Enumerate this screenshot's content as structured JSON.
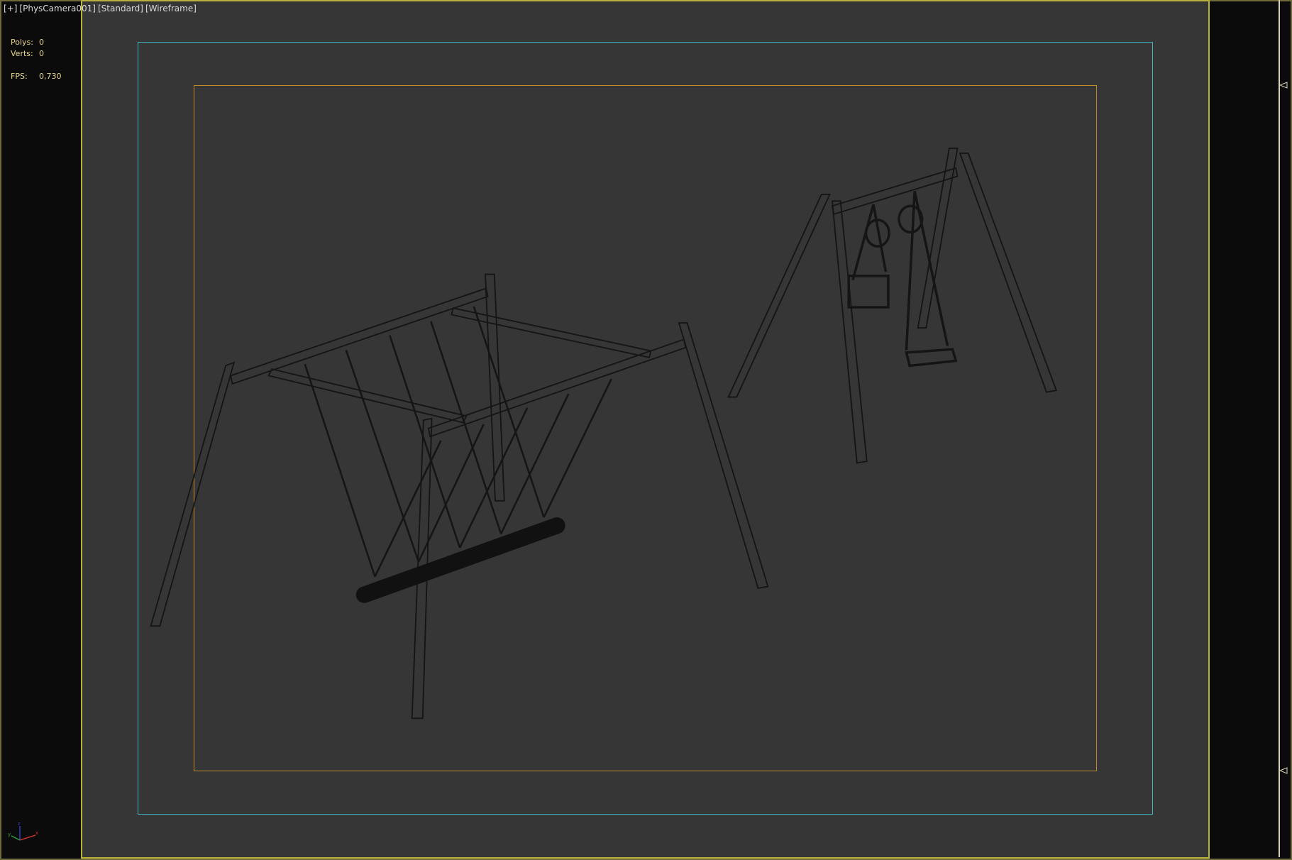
{
  "viewport": {
    "label": [
      "[+]",
      "[PhysCamera001]",
      "[Standard]",
      "[Wireframe]"
    ],
    "stats": [
      {
        "key": "Polys:",
        "value": "0"
      },
      {
        "key": "Verts:",
        "value": "0"
      },
      {
        "key": "FPS:",
        "value": "0,730"
      }
    ],
    "gizmo_axes": [
      "x",
      "y",
      "z"
    ]
  },
  "colors": {
    "viewport_bg": "#363636",
    "active_border": "#b9b23a",
    "safe_frame_outer": "#3fb5bf",
    "safe_frame_inner": "#c08a2a",
    "stats_text": "#e6d48a",
    "wire": "#111111"
  }
}
